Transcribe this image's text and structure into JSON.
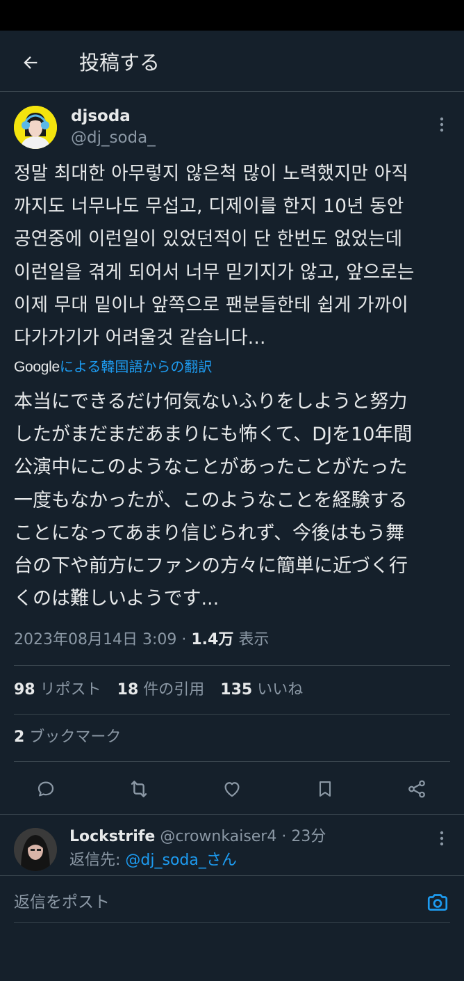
{
  "header": {
    "title": "投稿する"
  },
  "author": {
    "name": "djsoda",
    "handle": "@dj_soda_"
  },
  "tweet": {
    "text": "정말 최대한 아무렇지 않은척 많이 노력했지만 아직\n까지도 너무나도 무섭고, 디제이를 한지 10년 동안\n공연중에 이런일이 있었던적이 단 한번도 없었는데\n이런일을 겪게 되어서 너무 믿기지가 않고, 앞으로는\n이제 무대 밑이나 앞쪽으로 팬분들한테 쉽게 가까이\n다가가기가 어려울것 같습니다...",
    "translation_brand": "Google",
    "translation_label": "による韓国語からの翻訳",
    "translated_text": "本当にできるだけ何気ないふりをしようと努力\nしたがまだまだあまりにも怖くて、DJを10年間\n公演中にこのようなことがあったことがたった\n一度もなかったが、このようなことを経験する\nことになってあまり信じられず、今後はもう舞\n台の下や前方にファンの方々に簡単に近づく行\nくのは難しいようです..."
  },
  "meta": {
    "timestamp": "2023年08月14日 3:09",
    "separator": "·",
    "views_count": "1.4万",
    "views_label": "表示"
  },
  "stats": {
    "reposts_count": "98",
    "reposts_label": "リポスト",
    "quotes_count": "18",
    "quotes_label": "件の引用",
    "likes_count": "135",
    "likes_label": "いいね",
    "bookmarks_count": "2",
    "bookmarks_label": "ブックマーク"
  },
  "reply": {
    "name": "Lockstrife",
    "handle": "@crownkaiser4",
    "separator": "·",
    "time": "23分",
    "reply_to_label": "返信先:",
    "reply_to_mention": "@dj_soda_さん"
  },
  "compose": {
    "placeholder": "返信をポスト"
  },
  "icons": {
    "back": "arrow-left-icon",
    "more": "more-vertical-icon",
    "reply": "comment-icon",
    "repost": "retweet-icon",
    "like": "heart-icon",
    "bookmark": "bookmark-icon",
    "share": "share-icon",
    "camera": "camera-icon"
  },
  "colors": {
    "background": "#15202b",
    "accent": "#1d9bf0",
    "secondary_text": "#8b98a5",
    "divider": "#38444d"
  }
}
